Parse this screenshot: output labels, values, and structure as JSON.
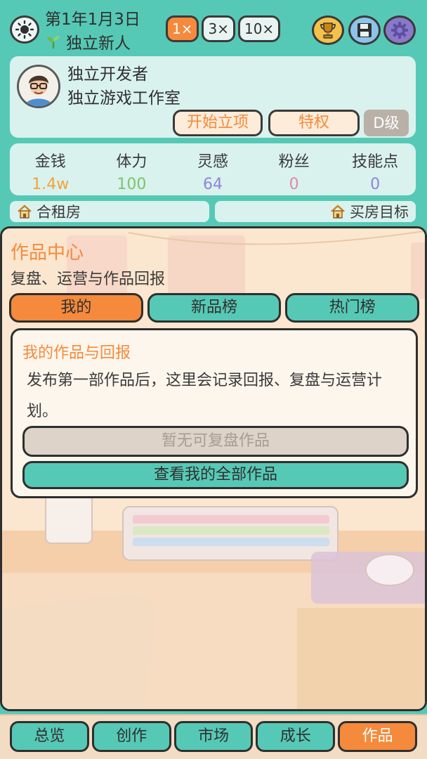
{
  "header": {
    "date": "第1年1月3日",
    "rank": "独立新人",
    "speeds": [
      "1×",
      "3×",
      "10×"
    ],
    "active_speed": 0,
    "icons": {
      "weather": "sun-icon",
      "trophy": "trophy-icon",
      "save": "save-icon",
      "settings": "gear-icon"
    }
  },
  "profile": {
    "name": "独立开发者",
    "studio": "独立游戏工作室",
    "start_button": "开始立项",
    "privilege_button": "特权",
    "grade": "D级"
  },
  "stats": [
    {
      "label": "金钱",
      "value": "1.4w",
      "color": "#f2a33a"
    },
    {
      "label": "体力",
      "value": "100",
      "color": "#7cc46b"
    },
    {
      "label": "灵感",
      "value": "64",
      "color": "#8f84d9"
    },
    {
      "label": "粉丝",
      "value": "0",
      "color": "#e08aa0"
    },
    {
      "label": "技能点",
      "value": "0",
      "color": "#8f84d9"
    }
  ],
  "housing": {
    "current": "合租房",
    "goal": "买房目标"
  },
  "main": {
    "title": "作品中心",
    "subtitle": "复盘、运营与作品回报",
    "tabs": [
      "我的",
      "新品榜",
      "热门榜"
    ],
    "active_tab": 0,
    "card": {
      "title": "我的作品与回报",
      "description": "发布第一部作品后，这里会记录回报、复盘与运营计划。",
      "disabled_button": "暂无可复盘作品",
      "view_button": "查看我的全部作品"
    }
  },
  "nav": {
    "items": [
      "总览",
      "创作",
      "市场",
      "成长",
      "作品"
    ],
    "active": 4
  },
  "colors": {
    "accent": "#f58a3c",
    "teal": "#56c9b6",
    "panel": "#d9f2ee"
  }
}
